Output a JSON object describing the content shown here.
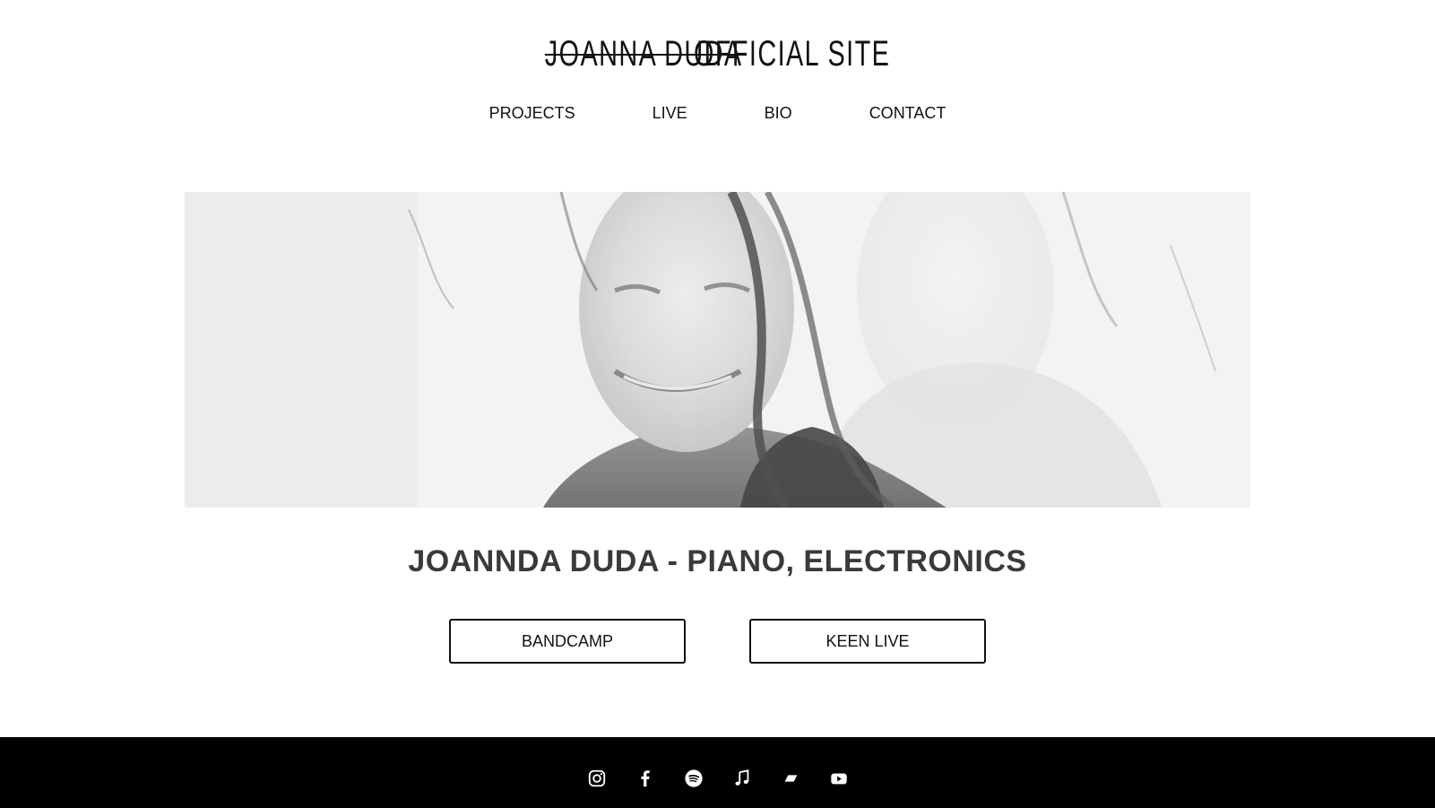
{
  "header": {
    "logo_name": "JOANNA DUDA",
    "logo_suffix": "OFFICIAL SITE"
  },
  "nav": {
    "items": [
      {
        "label": "PROJECTS"
      },
      {
        "label": "LIVE"
      },
      {
        "label": "BIO"
      },
      {
        "label": "CONTACT"
      }
    ]
  },
  "hero": {
    "image_icon": "portrait-photo"
  },
  "main": {
    "title": "JOANNDA DUDA - PIANO, ELECTRONICS",
    "buttons": [
      {
        "label": "BANDCAMP"
      },
      {
        "label": "KEEN LIVE"
      }
    ]
  },
  "footer": {
    "background": "#000000",
    "icons": [
      "instagram-icon",
      "facebook-icon",
      "spotify-icon",
      "apple-music-icon",
      "deezer-icon",
      "youtube-icon"
    ]
  }
}
